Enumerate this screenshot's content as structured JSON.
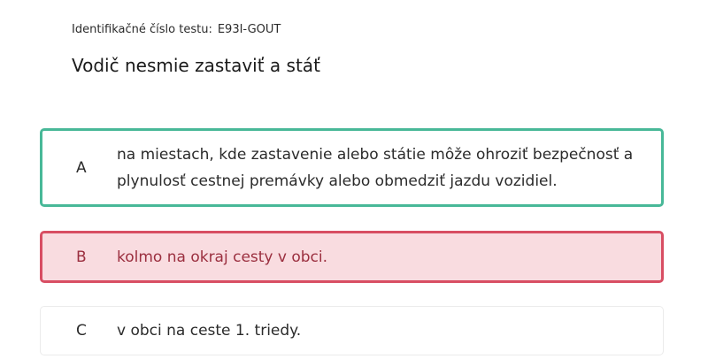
{
  "test": {
    "id_label": "Identifikačné číslo testu:",
    "id_value": "E93I-GOUT"
  },
  "question": {
    "text": "Vodič nesmie zastaviť a stáť"
  },
  "answers": [
    {
      "letter": "A",
      "text": "na miestach, kde zastavenie alebo státie môže ohroziť bezpečnosť a plynulosť cestnej premávky alebo obmedziť jazdu vozidiel.",
      "state": "correct"
    },
    {
      "letter": "B",
      "text": "kolmo na okraj cesty v obci.",
      "state": "incorrect"
    },
    {
      "letter": "C",
      "text": "v obci na ceste 1. triedy.",
      "state": "neutral"
    }
  ],
  "colors": {
    "correct_border": "#48b898",
    "incorrect_border": "#d84e63",
    "incorrect_background": "#f9dce0",
    "incorrect_text": "#9b2f3f"
  }
}
